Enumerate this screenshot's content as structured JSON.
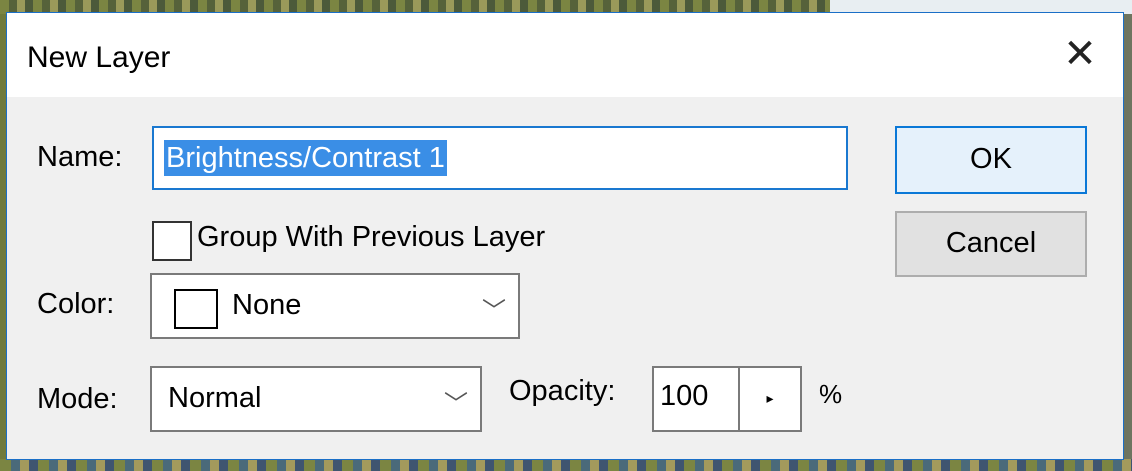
{
  "dialog": {
    "title": "New Layer",
    "close_glyph": "✕",
    "name_label": "Name:",
    "name_value": "Brightness/Contrast 1",
    "group_checkbox_label": "Group With Previous Layer",
    "group_checked": false,
    "color_label": "Color:",
    "color_value": "None",
    "mode_label": "Mode:",
    "mode_value": "Normal",
    "opacity_label": "Opacity:",
    "opacity_value": "100",
    "opacity_unit": "%",
    "stepper_glyph": "▸",
    "chevron_glyph": "﹀",
    "ok_label": "OK",
    "cancel_label": "Cancel"
  },
  "colors": {
    "accent": "#1a78d0",
    "selection": "#3a8ee6",
    "dialog_bg": "#f0f0f0"
  }
}
